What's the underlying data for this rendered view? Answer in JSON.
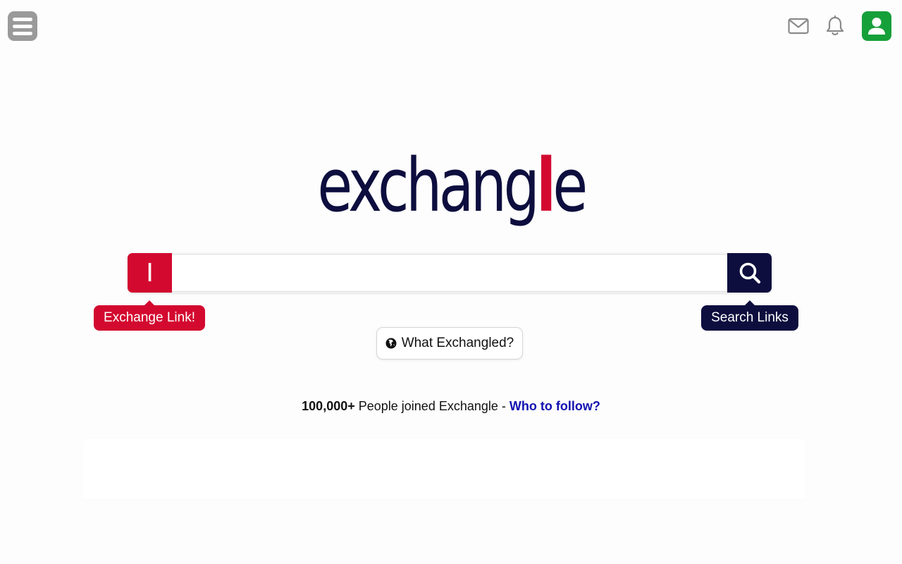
{
  "header": {
    "menu_icon": "hamburger-menu-icon",
    "mail_icon": "envelope-icon",
    "notification_icon": "bell-icon",
    "profile_icon": "user-icon"
  },
  "logo": {
    "before": "exchang",
    "accent": "l",
    "after": "e"
  },
  "search": {
    "exchange_button_glyph": "I",
    "input_value": "",
    "placeholder": "",
    "search_icon": "magnifier-icon",
    "exchange_tooltip": "Exchange Link!",
    "search_tooltip": "Search Links"
  },
  "what_button": {
    "icon": "globe-icon",
    "label": "What Exchangled?"
  },
  "joined": {
    "count": "100,000+",
    "text": " People joined Exchangle - ",
    "link": "Who to follow?"
  },
  "colors": {
    "brand_navy": "#0d0e3e",
    "brand_red": "#d3092f",
    "profile_green": "#16a03a",
    "link_blue": "#1110b0"
  }
}
